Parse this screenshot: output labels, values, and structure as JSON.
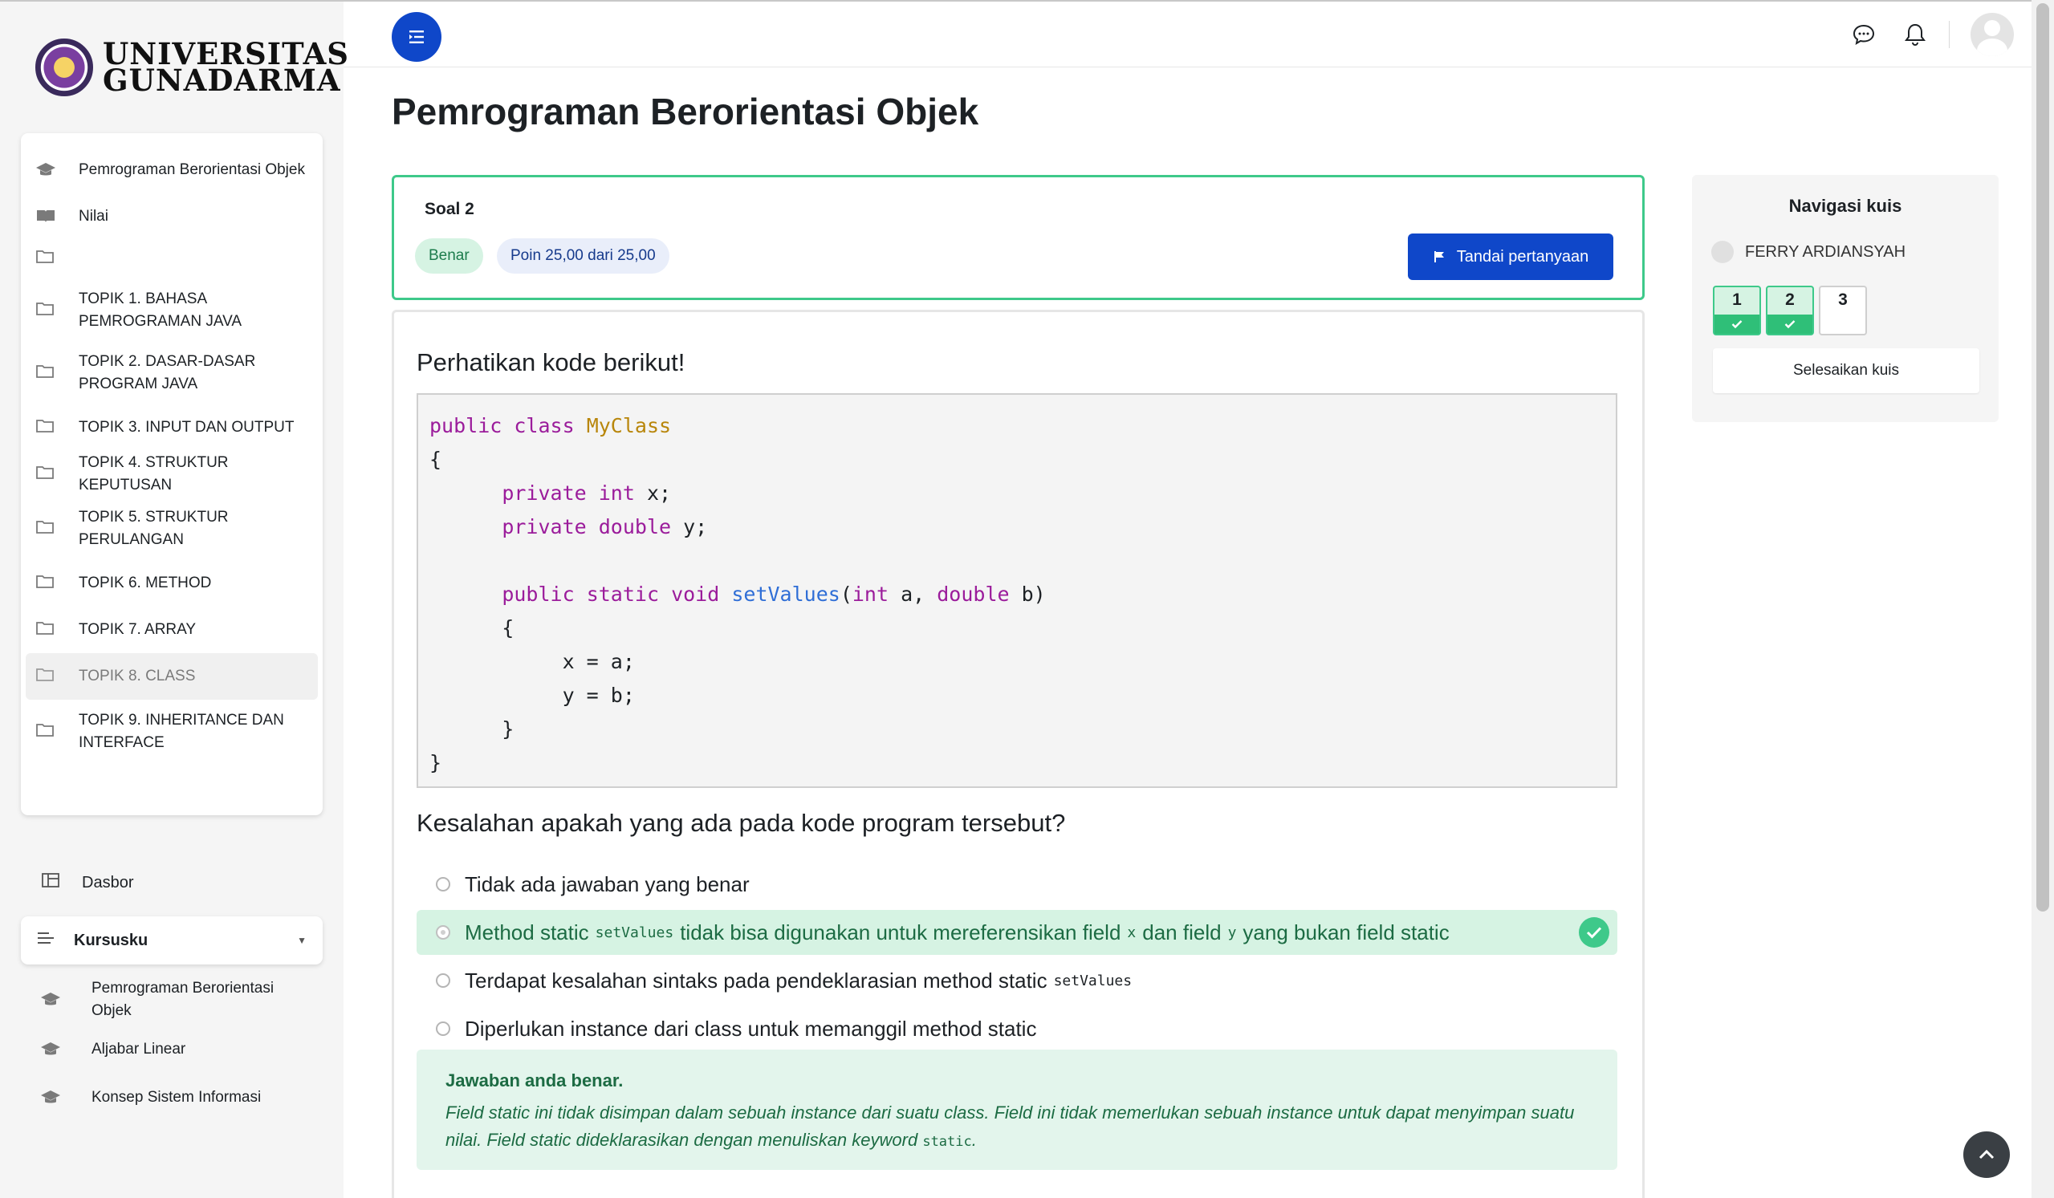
{
  "brand": {
    "name_line1": "UNIVERSITAS",
    "name_line2": "GUNADARMA"
  },
  "course_nav": {
    "items": [
      {
        "label": "Pemrograman Berorientasi Objek",
        "icon": "graduation-cap-icon"
      },
      {
        "label": "Nilai",
        "icon": "book-icon"
      },
      {
        "label": "",
        "icon": "folder-icon"
      },
      {
        "label": "TOPIK 1. BAHASA PEMROGRAMAN JAVA",
        "icon": "folder-icon"
      },
      {
        "label": "TOPIK 2. DASAR-DASAR PROGRAM JAVA",
        "icon": "folder-icon"
      },
      {
        "label": "TOPIK 3. INPUT DAN OUTPUT",
        "icon": "folder-icon"
      },
      {
        "label": "TOPIK 4. STRUKTUR KEPUTUSAN",
        "icon": "folder-icon"
      },
      {
        "label": "TOPIK 5. STRUKTUR PERULANGAN",
        "icon": "folder-icon"
      },
      {
        "label": "TOPIK 6. METHOD",
        "icon": "folder-icon"
      },
      {
        "label": "TOPIK 7. ARRAY",
        "icon": "folder-icon"
      },
      {
        "label": "TOPIK 8. CLASS",
        "icon": "folder-icon",
        "active": true
      },
      {
        "label": "TOPIK 9. INHERITANCE DAN INTERFACE",
        "icon": "folder-icon"
      }
    ]
  },
  "dasbor": {
    "label": "Dasbor",
    "icon": "dashboard-icon"
  },
  "kursusku": {
    "label": "Kursusku",
    "icon": "list-icon",
    "items": [
      {
        "label": "Pemrograman Berorientasi Objek"
      },
      {
        "label": "Aljabar Linear"
      },
      {
        "label": "Konsep Sistem Informasi"
      }
    ]
  },
  "topbar": {
    "menu_icon": "menu-toggle-icon",
    "icons": [
      "chat-icon",
      "bell-icon"
    ]
  },
  "page": {
    "title": "Pemrograman Berorientasi Objek"
  },
  "question": {
    "label": "Soal 2",
    "status": "Benar",
    "points": "Poin 25,00 dari 25,00",
    "flag_button": "Tandai pertanyaan",
    "intro": "Perhatikan kode berikut!",
    "prompt": "Kesalahan apakah yang ada pada kode program tersebut?",
    "code_lines": [
      "public class MyClass",
      "{",
      "      private int x;",
      "      private double y;",
      "",
      "      public static void setValues(int a, double b)",
      "      {",
      "           x = a;",
      "           y = b;",
      "      }",
      "}"
    ],
    "answers": [
      {
        "text": "Tidak ada jawaban yang benar"
      },
      {
        "parts": [
          "Method static",
          "setValues",
          "tidak bisa digunakan untuk mereferensikan field",
          "x",
          "dan field",
          "y",
          "yang bukan field static"
        ],
        "correct": true
      },
      {
        "parts": [
          "Terdapat kesalahan sintaks pada pendeklarasian method static",
          "setValues"
        ]
      },
      {
        "text": "Diperlukan instance dari class untuk memanggil method static"
      }
    ],
    "feedback": {
      "title": "Jawaban anda benar.",
      "text_before": "Field static ini tidak disimpan dalam sebuah instance dari suatu class. Field ini tidak memerlukan sebuah instance untuk dapat menyimpan suatu nilai. Field static dideklarasikan dengan menuliskan keyword",
      "keyword": "static",
      "text_after": "."
    }
  },
  "quiz_nav": {
    "title": "Navigasi kuis",
    "user": "FERRY ARDIANSYAH",
    "buttons": [
      {
        "label": "1",
        "answered": true
      },
      {
        "label": "2",
        "answered": true
      },
      {
        "label": "3",
        "answered": false
      }
    ],
    "finish_label": "Selesaikan kuis"
  },
  "colors": {
    "primary": "#0f47c9",
    "success": "#3ec98a",
    "success_bg": "#d6f3e3"
  }
}
